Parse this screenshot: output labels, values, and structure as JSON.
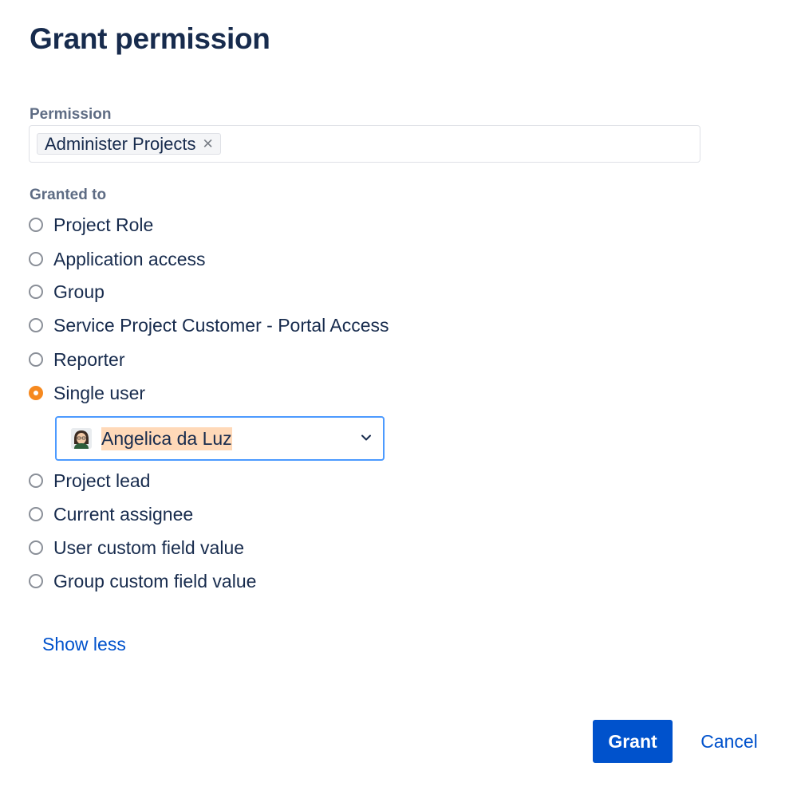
{
  "dialog": {
    "title": "Grant permission"
  },
  "permission": {
    "label": "Permission",
    "selected_tag": "Administer Projects",
    "remove_glyph": "✕"
  },
  "granted_to": {
    "label": "Granted to",
    "options": [
      {
        "label": "Project Role",
        "checked": false
      },
      {
        "label": "Application access",
        "checked": false
      },
      {
        "label": "Group",
        "checked": false
      },
      {
        "label": "Service Project Customer - Portal Access",
        "checked": false
      },
      {
        "label": "Reporter",
        "checked": false
      },
      {
        "label": "Single user",
        "checked": true
      },
      {
        "label": "Project lead",
        "checked": false
      },
      {
        "label": "Current assignee",
        "checked": false
      },
      {
        "label": "User custom field value",
        "checked": false
      },
      {
        "label": "Group custom field value",
        "checked": false
      }
    ],
    "user_select": {
      "value": "Angelica da Luz",
      "avatar_icon": "user-avatar",
      "dropdown_icon": "chevron-down-icon"
    }
  },
  "show_less_link": "Show less",
  "actions": {
    "grant": "Grant",
    "cancel": "Cancel"
  },
  "colors": {
    "primary": "#0052cc",
    "radio_checked": "#f6891f",
    "focus_border": "#4c9aff",
    "highlight": "#ffd9b8"
  }
}
